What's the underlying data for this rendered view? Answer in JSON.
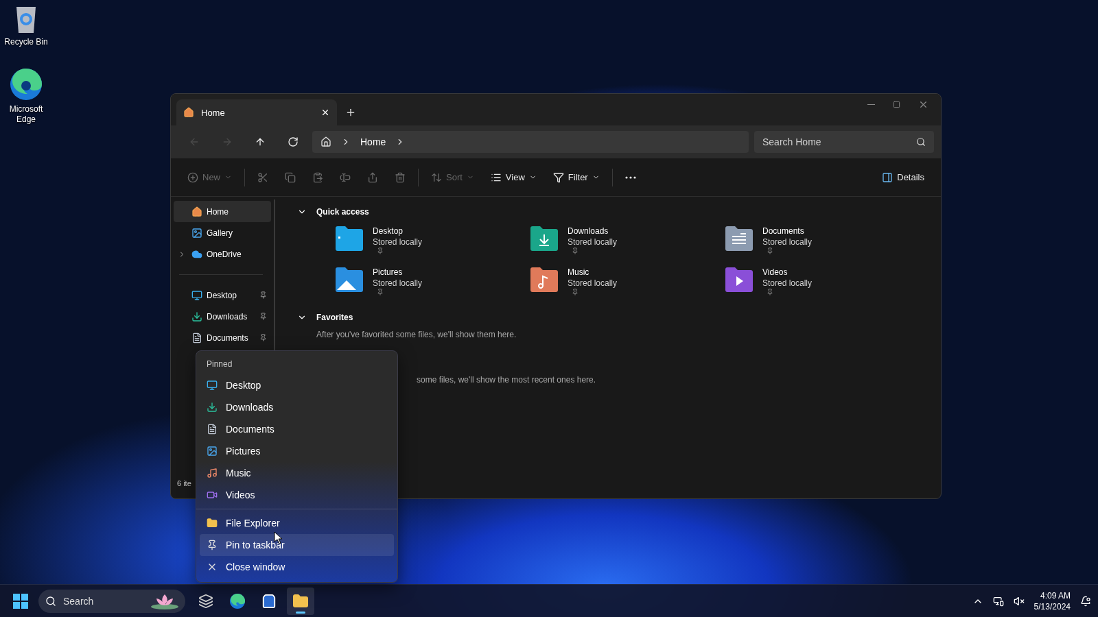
{
  "desktop_icons": [
    {
      "kind": "recycle",
      "label": "Recycle Bin"
    },
    {
      "kind": "edge",
      "label": "Microsoft Edge"
    }
  ],
  "window": {
    "tabs": [
      {
        "label": "Home",
        "selected": true
      }
    ],
    "nav": [
      {
        "kind": "back",
        "disabled": true
      },
      {
        "kind": "forward",
        "disabled": true
      },
      {
        "kind": "up",
        "disabled": false
      },
      {
        "kind": "refresh",
        "disabled": false
      }
    ],
    "breadcrumb": [
      "Home"
    ],
    "search": {
      "placeholder": "Search Home"
    },
    "toolbar": [
      {
        "kind": "new",
        "label": "New",
        "disabled": true
      },
      {
        "kind": "cut",
        "disabled": true
      },
      {
        "kind": "copy",
        "disabled": true
      },
      {
        "kind": "paste",
        "disabled": true
      },
      {
        "kind": "rename",
        "disabled": true
      },
      {
        "kind": "share",
        "disabled": true
      },
      {
        "kind": "delete",
        "disabled": true
      },
      {
        "kind": "sort",
        "label": "Sort",
        "disabled": true
      },
      {
        "kind": "view",
        "label": "View",
        "disabled": false
      },
      {
        "kind": "filter",
        "label": "Filter",
        "disabled": false
      },
      {
        "kind": "more",
        "disabled": false
      }
    ],
    "details_button": "Details",
    "sidebar": {
      "items": [
        {
          "kind": "home",
          "label": "Home",
          "selected": true
        },
        {
          "kind": "gallery",
          "label": "Gallery",
          "selected": false
        },
        {
          "kind": "onedrive",
          "label": "OneDrive",
          "selected": false,
          "expanded": false
        }
      ],
      "pinned": [
        {
          "kind": "desktop",
          "label": "Desktop",
          "pinned": true
        },
        {
          "kind": "downloads",
          "label": "Downloads",
          "pinned": true
        },
        {
          "kind": "documents",
          "label": "Documents",
          "pinned": true
        }
      ]
    },
    "quick_access": {
      "title": "Quick access",
      "expanded": true,
      "items": [
        {
          "kind": "desktop",
          "name": "Desktop",
          "status": "Stored locally",
          "color": "#1ea5e6",
          "pinned": true
        },
        {
          "kind": "downloads",
          "name": "Downloads",
          "status": "Stored locally",
          "color": "#1aa68a",
          "pinned": true
        },
        {
          "kind": "documents",
          "name": "Documents",
          "status": "Stored locally",
          "color": "#8c9bb0",
          "pinned": true
        },
        {
          "kind": "pictures",
          "name": "Pictures",
          "status": "Stored locally",
          "color": "#2a8fe0",
          "pinned": true
        },
        {
          "kind": "music",
          "name": "Music",
          "status": "Stored locally",
          "color": "#e07a5a",
          "pinned": true
        },
        {
          "kind": "videos",
          "name": "Videos",
          "status": "Stored locally",
          "color": "#8a4fd8",
          "pinned": true
        }
      ]
    },
    "favorites": {
      "title": "Favorites",
      "expanded": true,
      "message": "After you've favorited some files, we'll show them here."
    },
    "recent": {
      "message": "some files, we'll show the most recent ones here."
    },
    "status_bar": "6 ite"
  },
  "jump_list": {
    "heading": "Pinned",
    "pinned": [
      {
        "kind": "desktop",
        "label": "Desktop"
      },
      {
        "kind": "downloads",
        "label": "Downloads"
      },
      {
        "kind": "documents",
        "label": "Documents"
      },
      {
        "kind": "pictures",
        "label": "Pictures"
      },
      {
        "kind": "music",
        "label": "Music"
      },
      {
        "kind": "videos",
        "label": "Videos"
      }
    ],
    "actions": [
      {
        "kind": "explorer",
        "label": "File Explorer",
        "highlighted": false
      },
      {
        "kind": "pin",
        "label": "Pin to taskbar",
        "highlighted": true
      },
      {
        "kind": "close",
        "label": "Close window",
        "highlighted": false
      }
    ]
  },
  "taskbar": {
    "search_placeholder": "Search",
    "apps": [
      {
        "kind": "taskview",
        "running": false
      },
      {
        "kind": "edge",
        "running": false
      },
      {
        "kind": "store",
        "running": false
      },
      {
        "kind": "explorer",
        "running": true
      }
    ],
    "time": "4:09 AM",
    "date": "5/13/2024"
  }
}
